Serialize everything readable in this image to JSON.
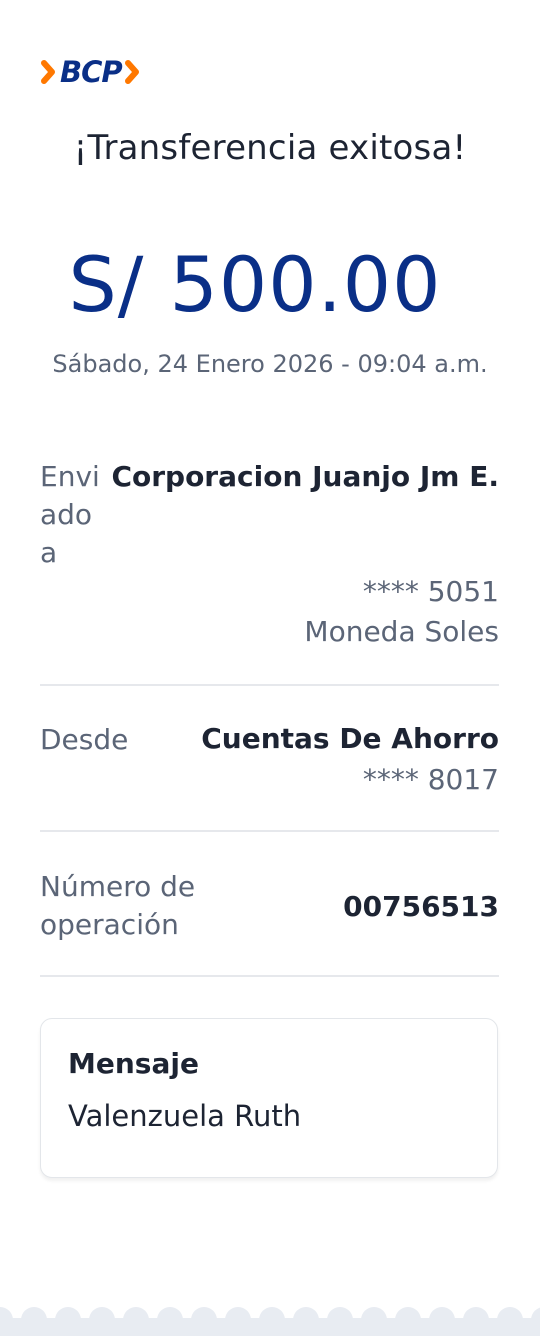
{
  "logo": {
    "brand": "BCP",
    "colors": {
      "brand_blue": "#0a2f87",
      "accent_orange": "#ff7800"
    }
  },
  "title": "¡Transferencia exitosa!",
  "amount": "S/ 500.00",
  "datetime": "Sábado, 24 Enero 2026 - 09:04 a.m.",
  "sent_to": {
    "label_lines": [
      "Envi",
      "ado",
      "a"
    ],
    "name": "Corporacion Juanjo Jm E.",
    "account": "**** 5051",
    "currency": "Moneda Soles"
  },
  "from": {
    "label": "Desde",
    "account_type": "Cuentas De Ahorro",
    "account": "**** 8017"
  },
  "operation": {
    "label_lines": [
      "Número de",
      "operación"
    ],
    "number": "00756513"
  },
  "message": {
    "title": "Mensaje",
    "body": "Valenzuela Ruth"
  },
  "colors": {
    "primary_text": "#1d2433",
    "secondary_text": "#5b6577",
    "amount_blue": "#0a2f87",
    "divider": "#e6e8ec",
    "footer_scallop": "#e8ecf2"
  }
}
